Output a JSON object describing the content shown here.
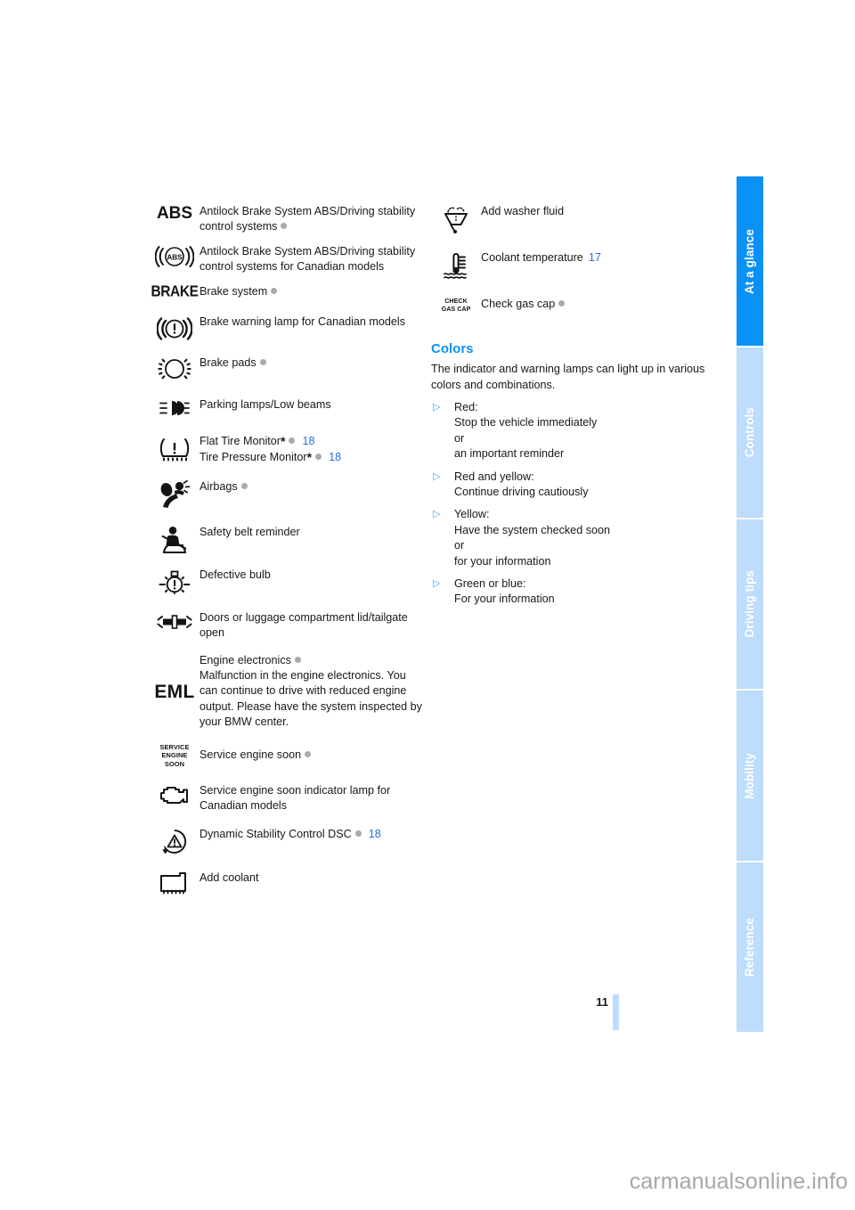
{
  "document": {
    "page_number": "11",
    "watermark": "carmanualsonline.info"
  },
  "side_tabs": [
    {
      "label": "At a glance",
      "active": true
    },
    {
      "label": "Controls",
      "active": false
    },
    {
      "label": "Driving tips",
      "active": false
    },
    {
      "label": "Mobility",
      "active": false
    },
    {
      "label": "Reference",
      "active": false
    }
  ],
  "left_column": {
    "rows": [
      {
        "icon": "abs-text-icon",
        "icon_text": "ABS",
        "text": "Antilock Brake System ABS/Driving stability control systems",
        "dot": true,
        "page_ref": ""
      },
      {
        "icon": "abs-canadian-icon",
        "icon_text": "ABS",
        "text": "Antilock Brake System ABS/Driving stability control systems for Canadian models",
        "dot": false,
        "page_ref": ""
      },
      {
        "icon": "brake-text-icon",
        "icon_text": "BRAKE",
        "text": "Brake system",
        "dot": true,
        "page_ref": ""
      },
      {
        "icon": "brake-warning-canadian-icon",
        "icon_text": "",
        "text": "Brake warning lamp for Canadian models",
        "dot": false,
        "page_ref": ""
      },
      {
        "icon": "brake-pads-icon",
        "icon_text": "",
        "text": "Brake pads",
        "dot": true,
        "page_ref": ""
      },
      {
        "icon": "parking-lamps-low-beams-icon",
        "icon_text": "",
        "text": "Parking lamps/Low beams",
        "dot": false,
        "page_ref": ""
      },
      {
        "icon": "tire-monitor-icon",
        "icon_text": "",
        "text": "",
        "dot": false,
        "page_ref": "",
        "two_line": {
          "line1_text": "Flat Tire Monitor",
          "line1_star": "*",
          "line1_dot": true,
          "line1_ref": "18",
          "line2_text": "Tire Pressure Monitor",
          "line2_star": "*",
          "line2_dot": true,
          "line2_ref": "18"
        }
      },
      {
        "icon": "airbags-icon",
        "icon_text": "",
        "text": "Airbags",
        "dot": true,
        "page_ref": ""
      },
      {
        "icon": "safety-belt-reminder-icon",
        "icon_text": "",
        "text": "Safety belt reminder",
        "dot": false,
        "page_ref": ""
      },
      {
        "icon": "defective-bulb-icon",
        "icon_text": "",
        "text": "Defective bulb",
        "dot": false,
        "page_ref": ""
      },
      {
        "icon": "doors-open-icon",
        "icon_text": "",
        "text": "Doors or luggage compartment lid/tailgate open",
        "dot": false,
        "page_ref": ""
      },
      {
        "icon": "eml-text-icon",
        "icon_text": "EML",
        "text": "Engine electronics",
        "dot": true,
        "page_ref": "",
        "extra_text": "Malfunction in the engine electronics. You can continue to drive with reduced engine output. Please have the system inspected by your BMW center."
      },
      {
        "icon": "service-engine-soon-text-icon",
        "icon_text": "SERVICE\nENGINE\nSOON",
        "text": "Service engine soon",
        "dot": true,
        "page_ref": ""
      },
      {
        "icon": "check-engine-canadian-icon",
        "icon_text": "",
        "text": "Service engine soon indicator lamp for Canadian models",
        "dot": false,
        "page_ref": ""
      },
      {
        "icon": "dsc-icon",
        "icon_text": "",
        "text": "Dynamic Stability Control DSC",
        "dot": true,
        "page_ref": "18"
      },
      {
        "icon": "add-coolant-icon",
        "icon_text": "",
        "text": "Add coolant",
        "dot": false,
        "page_ref": ""
      }
    ]
  },
  "right_column": {
    "rows": [
      {
        "icon": "washer-fluid-icon",
        "text": "Add washer fluid",
        "dot": false,
        "page_ref": ""
      },
      {
        "icon": "coolant-temperature-icon",
        "text": "Coolant temperature",
        "dot": false,
        "page_ref": "17"
      },
      {
        "icon": "check-gas-cap-text-icon",
        "icon_text": "CHECK\nGAS CAP",
        "text": "Check gas cap",
        "dot": true,
        "page_ref": ""
      }
    ],
    "section": {
      "title": "Colors",
      "intro": "The indicator and warning lamps can light up in various colors and combinations.",
      "bullets": [
        {
          "mark": "▷",
          "body": "Red:\nStop the vehicle immediately\nor\nan important reminder"
        },
        {
          "mark": "▷",
          "body": "Red and yellow:\nContinue driving cautiously"
        },
        {
          "mark": "▷",
          "body": "Yellow:\nHave the system checked soon\nor\nfor your information"
        },
        {
          "mark": "▷",
          "body": "Green or blue:\nFor your information"
        }
      ]
    }
  },
  "colors": {
    "accent_blue": "#0a91f5",
    "tab_inactive": "#bedcfb",
    "ref_blue": "#1f6fe0",
    "dot_gray": "#a9aaac",
    "text": "#17181a"
  }
}
